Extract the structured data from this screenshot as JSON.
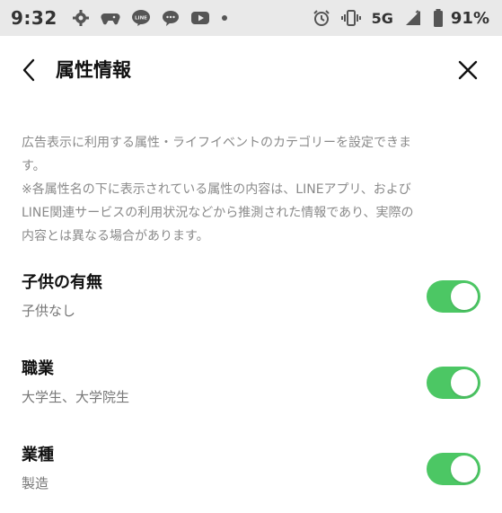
{
  "status_bar": {
    "time": "9:32",
    "network": "5G",
    "battery": "91%"
  },
  "header": {
    "title": "属性情報"
  },
  "description": {
    "line1": "広告表示に利用する属性・ライフイベントのカテゴリーを設定できま",
    "line2": "す。",
    "line3": "※各属性名の下に表示されている属性の内容は、LINEアプリ、および",
    "line4": "LINE関連サービスの利用状況などから推測された情報であり、実際の",
    "line5": "内容とは異なる場合があります。"
  },
  "settings": [
    {
      "label": "子供の有無",
      "value": "子供なし",
      "enabled": true
    },
    {
      "label": "職業",
      "value": "大学生、大学院生",
      "enabled": true
    },
    {
      "label": "業種",
      "value": "製造",
      "enabled": true
    }
  ],
  "colors": {
    "toggle_on": "#4cc764",
    "status_bar_bg": "#e9e9e9",
    "description_text": "#8a8a8a"
  }
}
